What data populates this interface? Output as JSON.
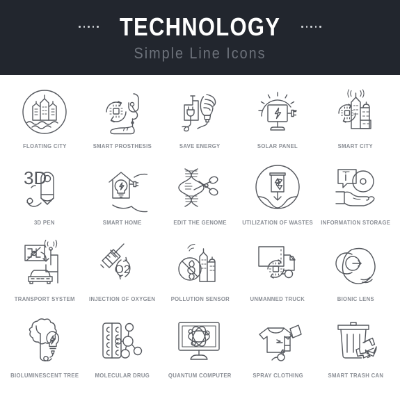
{
  "header": {
    "title": "TECHNOLOGY",
    "subtitle": "Simple Line Icons",
    "dot_count_left": 5,
    "dot_count_right": 5,
    "background_color": "#22262e",
    "title_color": "#ffffff",
    "subtitle_color": "#6e737c"
  },
  "grid": {
    "columns": 5,
    "rows": 4,
    "label_color": "#8a8e95",
    "icon_stroke_color": "#55585e",
    "items": [
      {
        "id": "floating-city",
        "label": "FLOATING CITY",
        "icon": "floating-city-icon"
      },
      {
        "id": "smart-prosthesis",
        "label": "SMART PROSTHESIS",
        "icon": "smart-prosthesis-icon"
      },
      {
        "id": "save-energy",
        "label": "SAVE ENERGY",
        "icon": "save-energy-icon"
      },
      {
        "id": "solar-panel",
        "label": "SOLAR PANEL",
        "icon": "solar-panel-icon"
      },
      {
        "id": "smart-city",
        "label": "SMART CITY",
        "icon": "smart-city-icon"
      },
      {
        "id": "3d-pen",
        "label": "3D PEN",
        "icon": "3d-pen-icon",
        "icon_text": "3D"
      },
      {
        "id": "smart-home",
        "label": "SMART HOME",
        "icon": "smart-home-icon"
      },
      {
        "id": "edit-the-genome",
        "label": "EDIT THE GENOME",
        "icon": "edit-the-genome-icon"
      },
      {
        "id": "utilization-of-wastes",
        "label": "UTILIZATION OF WASTES",
        "icon": "utilization-of-wastes-icon"
      },
      {
        "id": "information-storage",
        "label": "INFORMATION STORAGE",
        "icon": "information-storage-icon",
        "icon_text": "i"
      },
      {
        "id": "transport-system",
        "label": "TRANSPORT SYSTEM",
        "icon": "transport-system-icon"
      },
      {
        "id": "injection-of-oxygen",
        "label": "INJECTION OF OXYGEN",
        "icon": "injection-of-oxygen-icon",
        "icon_text": "O2"
      },
      {
        "id": "pollution-sensor",
        "label": "POLLUTION SENSOR",
        "icon": "pollution-sensor-icon"
      },
      {
        "id": "unmanned-truck",
        "label": "UNMANNED TRUCK",
        "icon": "unmanned-truck-icon"
      },
      {
        "id": "bionic-lens",
        "label": "BIONIC LENS",
        "icon": "bionic-lens-icon"
      },
      {
        "id": "bioluminescent-tree",
        "label": "BIOLUMINESCENT TREE",
        "icon": "bioluminescent-tree-icon"
      },
      {
        "id": "molecular-drug",
        "label": "MOLECULAR DRUG",
        "icon": "molecular-drug-icon"
      },
      {
        "id": "quantum-computer",
        "label": "QUANTUM COMPUTER",
        "icon": "quantum-computer-icon"
      },
      {
        "id": "spray-clothing",
        "label": "SPRAY CLOTHING",
        "icon": "spray-clothing-icon"
      },
      {
        "id": "smart-trash-can",
        "label": "SMART TRASH CAN",
        "icon": "smart-trash-can-icon"
      }
    ]
  }
}
